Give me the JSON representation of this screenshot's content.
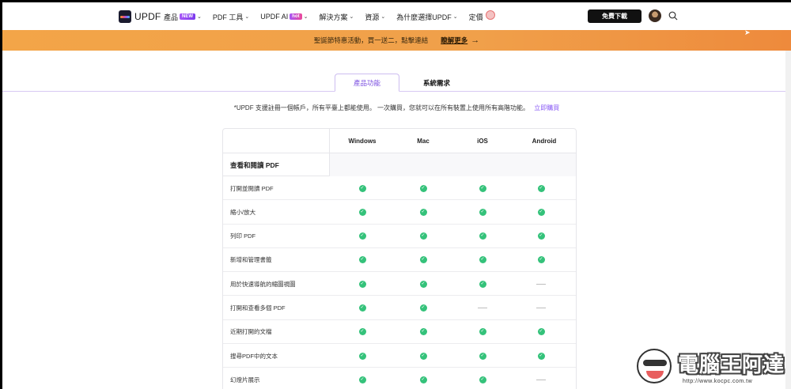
{
  "nav": {
    "logo_text": "UPDF",
    "items": [
      {
        "label": "產品",
        "badge": "NEW",
        "has_chevron": true
      },
      {
        "label": "PDF 工具",
        "has_chevron": true
      },
      {
        "label": "UPDF AI",
        "badge": "hot",
        "has_chevron": true
      },
      {
        "label": "解決方案",
        "has_chevron": true
      },
      {
        "label": "資源",
        "has_chevron": true
      },
      {
        "label": "為什麼選擇UPDF",
        "has_chevron": true
      },
      {
        "label": "定價"
      }
    ],
    "download_label": "免費下載",
    "icons": {
      "search": "search-icon",
      "chevron": "chevron-down-icon"
    }
  },
  "banner": {
    "text": "聖誕節特惠活動，買一送二，點擊連結",
    "link": "瞭解更多",
    "arrow": "→"
  },
  "tabs": [
    {
      "label": "產品功能",
      "active": true
    },
    {
      "label": "系統需求",
      "active": false
    }
  ],
  "note": {
    "text": "*UPDF 支援註冊一個帳戶，所有平臺上都能使用。 一次購買，您就可以在所有裝置上使用所有高階功能。",
    "link": "立即購買"
  },
  "table": {
    "columns": [
      "Windows",
      "Mac",
      "iOS",
      "Android"
    ],
    "section": "查看和閱讀 PDF",
    "rows": [
      {
        "label": "打開並閱讀 PDF",
        "support": [
          true,
          true,
          true,
          true
        ]
      },
      {
        "label": "縮小/放大",
        "support": [
          true,
          true,
          true,
          true
        ]
      },
      {
        "label": "列印 PDF",
        "support": [
          true,
          true,
          true,
          true
        ]
      },
      {
        "label": "新增和管理書籤",
        "support": [
          true,
          true,
          true,
          true
        ]
      },
      {
        "label": "用於快速導航的縮圖視圖",
        "support": [
          true,
          true,
          true,
          false
        ]
      },
      {
        "label": "打開和查看多個 PDF",
        "support": [
          true,
          true,
          false,
          false
        ]
      },
      {
        "label": "近期打開的文檔",
        "support": [
          true,
          true,
          true,
          true
        ]
      },
      {
        "label": "搜尋PDF中的文本",
        "support": [
          true,
          true,
          true,
          true
        ]
      },
      {
        "label": "幻燈片展示",
        "support": [
          true,
          true,
          true,
          false
        ]
      }
    ],
    "colors": {
      "check": "#34c27a",
      "dash": "#bdbdbd"
    }
  },
  "watermark": {
    "title": "電腦王阿達",
    "url": "http://www.kocpc.com.tw"
  },
  "colors": {
    "accent": "#7b4fe0",
    "banner": "#f0a04a",
    "dark_button": "#111111"
  }
}
